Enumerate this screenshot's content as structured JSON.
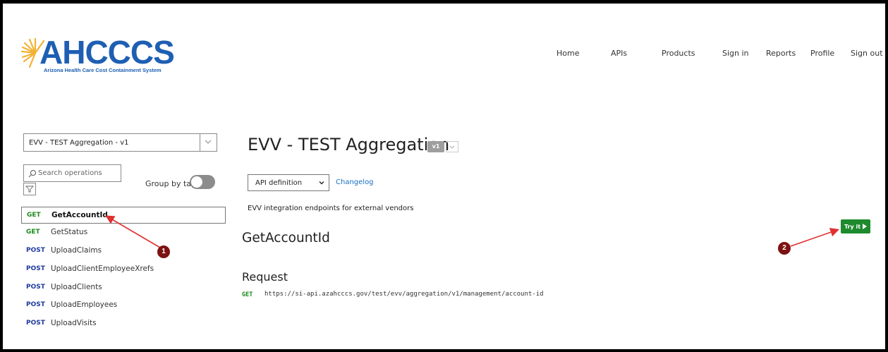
{
  "logo": {
    "name": "AHCCCS",
    "tagline": "Arizona Health Care Cost Containment System"
  },
  "nav": [
    "Home",
    "APIs",
    "Products",
    "Sign in",
    "Reports",
    "Profile",
    "Sign out"
  ],
  "sidebar": {
    "api_selector": "EVV - TEST Aggregation - v1",
    "search_placeholder": "Search operations",
    "group_by_tag_label": "Group by tag",
    "group_by_tag_on": false,
    "operations": [
      {
        "method": "GET",
        "name": "GetAccountId",
        "selected": true
      },
      {
        "method": "GET",
        "name": "GetStatus",
        "selected": false
      },
      {
        "method": "POST",
        "name": "UploadClaims",
        "selected": false
      },
      {
        "method": "POST",
        "name": "UploadClientEmployeeXrefs",
        "selected": false
      },
      {
        "method": "POST",
        "name": "UploadClients",
        "selected": false
      },
      {
        "method": "POST",
        "name": "UploadEmployees",
        "selected": false
      },
      {
        "method": "POST",
        "name": "UploadVisits",
        "selected": false
      }
    ]
  },
  "main": {
    "api_title": "EVV - TEST Aggregation",
    "version": "v1",
    "definition_select": "API definition",
    "changelog_link": "Changelog",
    "description": "EVV integration endpoints for external vendors",
    "operation_title": "GetAccountId",
    "try_it_label": "Try it",
    "request": {
      "heading": "Request",
      "method": "GET",
      "url": "https://si-api.azahcccs.gov/test/evv/aggregation/v1/management/account-id"
    }
  },
  "annotations": [
    {
      "label": "1"
    },
    {
      "label": "2"
    }
  ],
  "colors": {
    "brand_blue": "#1e5fb3",
    "get_green": "#1b8a1b",
    "post_blue": "#1f3a9e",
    "try_green": "#1e8a2e",
    "marker_red": "#7d1212",
    "arrow_red": "#e03030"
  }
}
